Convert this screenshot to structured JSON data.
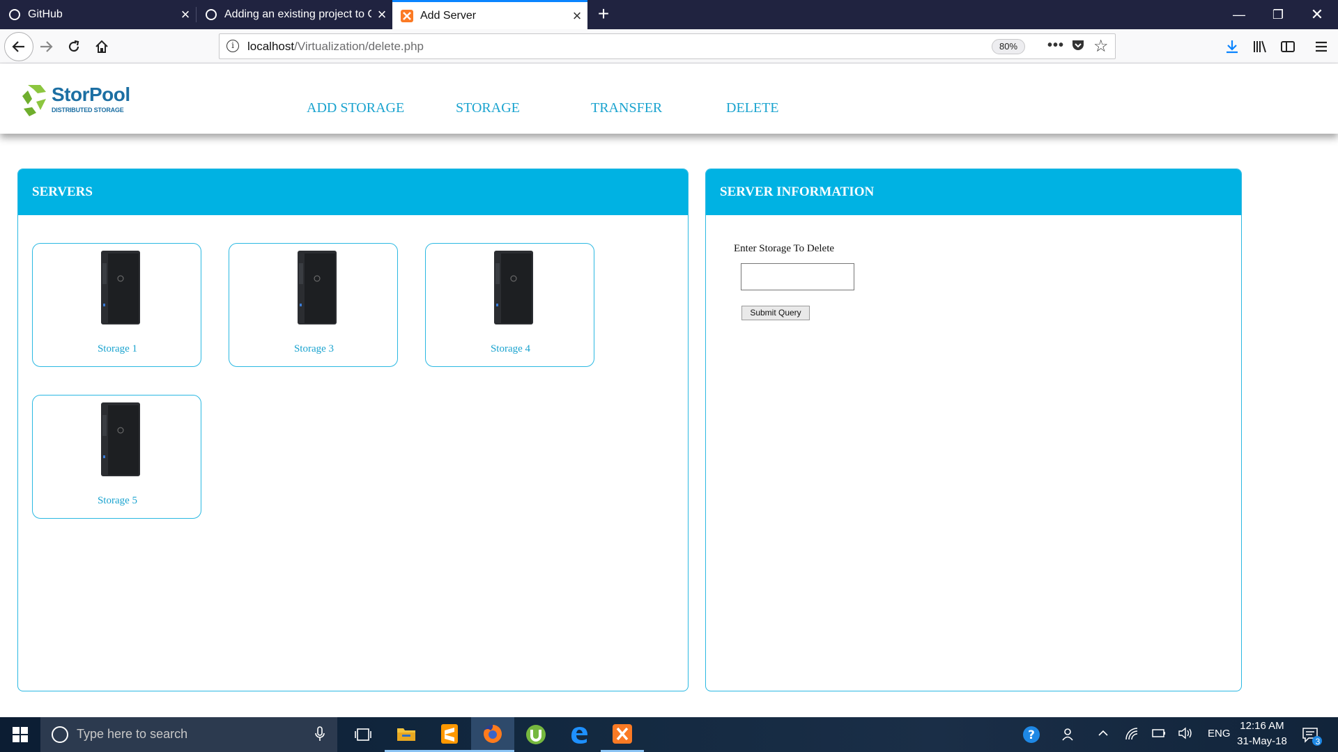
{
  "browser": {
    "tabs": [
      {
        "title": "GitHub",
        "icon": "github-icon",
        "active": false
      },
      {
        "title": "Adding an existing project to G",
        "icon": "github-icon",
        "active": false
      },
      {
        "title": "Add Server",
        "icon": "xampp-icon",
        "active": true
      }
    ],
    "new_tab": "+",
    "url_host": "localhost",
    "url_path": "/Virtualization/delete.php",
    "zoom": "80%",
    "accent_color": "#0a84ff"
  },
  "site": {
    "logo_name": "StorPool",
    "logo_tagline": "DISTRIBUTED STORAGE",
    "menu": [
      "ADD STORAGE",
      "STORAGE",
      "TRANSFER",
      "DELETE"
    ],
    "brand_color": "#00b2e3"
  },
  "servers_panel": {
    "title": "SERVERS",
    "servers": [
      "Storage 1",
      "Storage 3",
      "Storage 4",
      "Storage 5"
    ]
  },
  "info_panel": {
    "title": "SERVER INFORMATION",
    "field_label": "Enter Storage To Delete",
    "field_value": "",
    "submit_label": "Submit Query"
  },
  "taskbar": {
    "search_placeholder": "Type here to search",
    "apps": [
      "task-view-icon",
      "file-explorer-icon",
      "sublime-text-icon",
      "firefox-icon",
      "utorrent-icon",
      "edge-icon",
      "xampp-icon"
    ],
    "language": "ENG",
    "time": "12:16 AM",
    "date": "31-May-18",
    "notification_count": "3"
  }
}
